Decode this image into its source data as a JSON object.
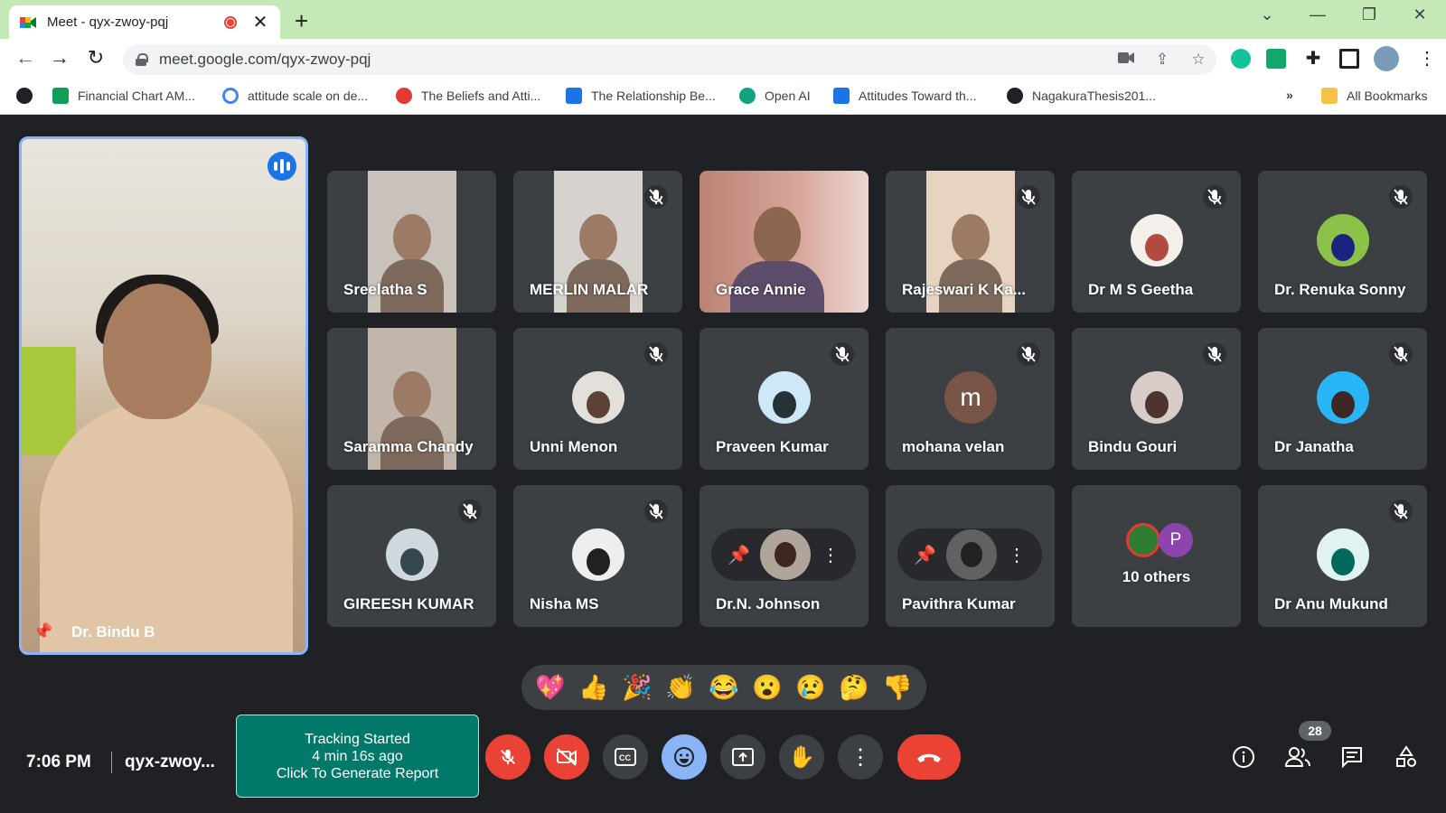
{
  "browser": {
    "tab_title": "Meet - qyx-zwoy-pqj",
    "url": "meet.google.com/qyx-zwoy-pqj",
    "bookmarks": [
      {
        "label": "Financial Chart AM...",
        "color": "#0f9d58"
      },
      {
        "label": "attitude scale on de...",
        "color": "#4285f4"
      },
      {
        "label": "The Beliefs and Atti...",
        "color": "#e53935"
      },
      {
        "label": "The Relationship Be...",
        "color": "#1a73e8"
      },
      {
        "label": "Open AI",
        "color": "#10a37f"
      },
      {
        "label": "Attitudes Toward th...",
        "color": "#1a73e8"
      },
      {
        "label": "NagakuraThesis201...",
        "color": "#202124"
      }
    ],
    "more_bookmarks": "»",
    "all_bookmarks": "All Bookmarks"
  },
  "main_speaker": {
    "name": "Dr. Bindu B"
  },
  "participants": [
    {
      "name": "Sreelatha S",
      "type": "video",
      "muted": false,
      "bg": "#c9c2ba"
    },
    {
      "name": "MERLIN MALAR",
      "type": "video",
      "muted": true,
      "bg": "#d6d3cf"
    },
    {
      "name": "Grace Annie",
      "type": "video-full",
      "muted": false,
      "bg": "#b98274"
    },
    {
      "name": "Rajeswari K Ka...",
      "type": "video",
      "muted": true,
      "bg": "#e6d4c0"
    },
    {
      "name": "Dr M S Geetha",
      "type": "avatar",
      "muted": true,
      "bg": "#f3efe9",
      "fg": "#b24a40"
    },
    {
      "name": "Dr. Renuka Sonny",
      "type": "avatar",
      "muted": true,
      "bg": "#8bc34a",
      "fg": "#1a237e"
    },
    {
      "name": "Saramma Chandy",
      "type": "video",
      "muted": false,
      "bg": "#c2b6ab"
    },
    {
      "name": "Unni Menon",
      "type": "avatar",
      "muted": true,
      "bg": "#e3e0dc",
      "fg": "#5d4037"
    },
    {
      "name": "Praveen Kumar",
      "type": "avatar",
      "muted": true,
      "bg": "#cfe8f7",
      "fg": "#263238"
    },
    {
      "name": "mohana velan",
      "type": "letter",
      "letter": "m",
      "muted": true,
      "bg": "#795548"
    },
    {
      "name": "Bindu Gouri",
      "type": "avatar",
      "muted": true,
      "bg": "#d7ccc8",
      "fg": "#4e342e"
    },
    {
      "name": "Dr Janatha",
      "type": "avatar",
      "muted": true,
      "bg": "#29b6f6",
      "fg": "#3e2723"
    },
    {
      "name": "GIREESH KUMAR",
      "type": "avatar",
      "muted": true,
      "bg": "#cfd8dc",
      "fg": "#37474f"
    },
    {
      "name": "Nisha MS",
      "type": "avatar",
      "muted": true,
      "bg": "#eeeeee",
      "fg": "#212121"
    },
    {
      "name": "Dr.N. Johnson",
      "type": "hover",
      "muted": true,
      "bg": "#b0a59a",
      "fg": "#3e2723"
    },
    {
      "name": "Pavithra Kumar",
      "type": "hover",
      "muted": true,
      "bg": "#616161",
      "fg": "#212121"
    },
    {
      "name": "10 others",
      "type": "others",
      "muted": false,
      "others_letter": "P"
    },
    {
      "name": "Dr Anu Mukund",
      "type": "avatar",
      "muted": true,
      "bg": "#e0f2f1",
      "fg": "#00695c"
    }
  ],
  "reactions": [
    "💖",
    "👍",
    "🎉",
    "👏",
    "😂",
    "😮",
    "😢",
    "🤔",
    "👎"
  ],
  "bottom": {
    "time": "7:06 PM",
    "meeting_code": "qyx-zwoy...",
    "tracking_line1": "Tracking Started",
    "tracking_line2": "4 min 16s ago",
    "tracking_line3": "Click To Generate Report",
    "people_count": "28"
  }
}
